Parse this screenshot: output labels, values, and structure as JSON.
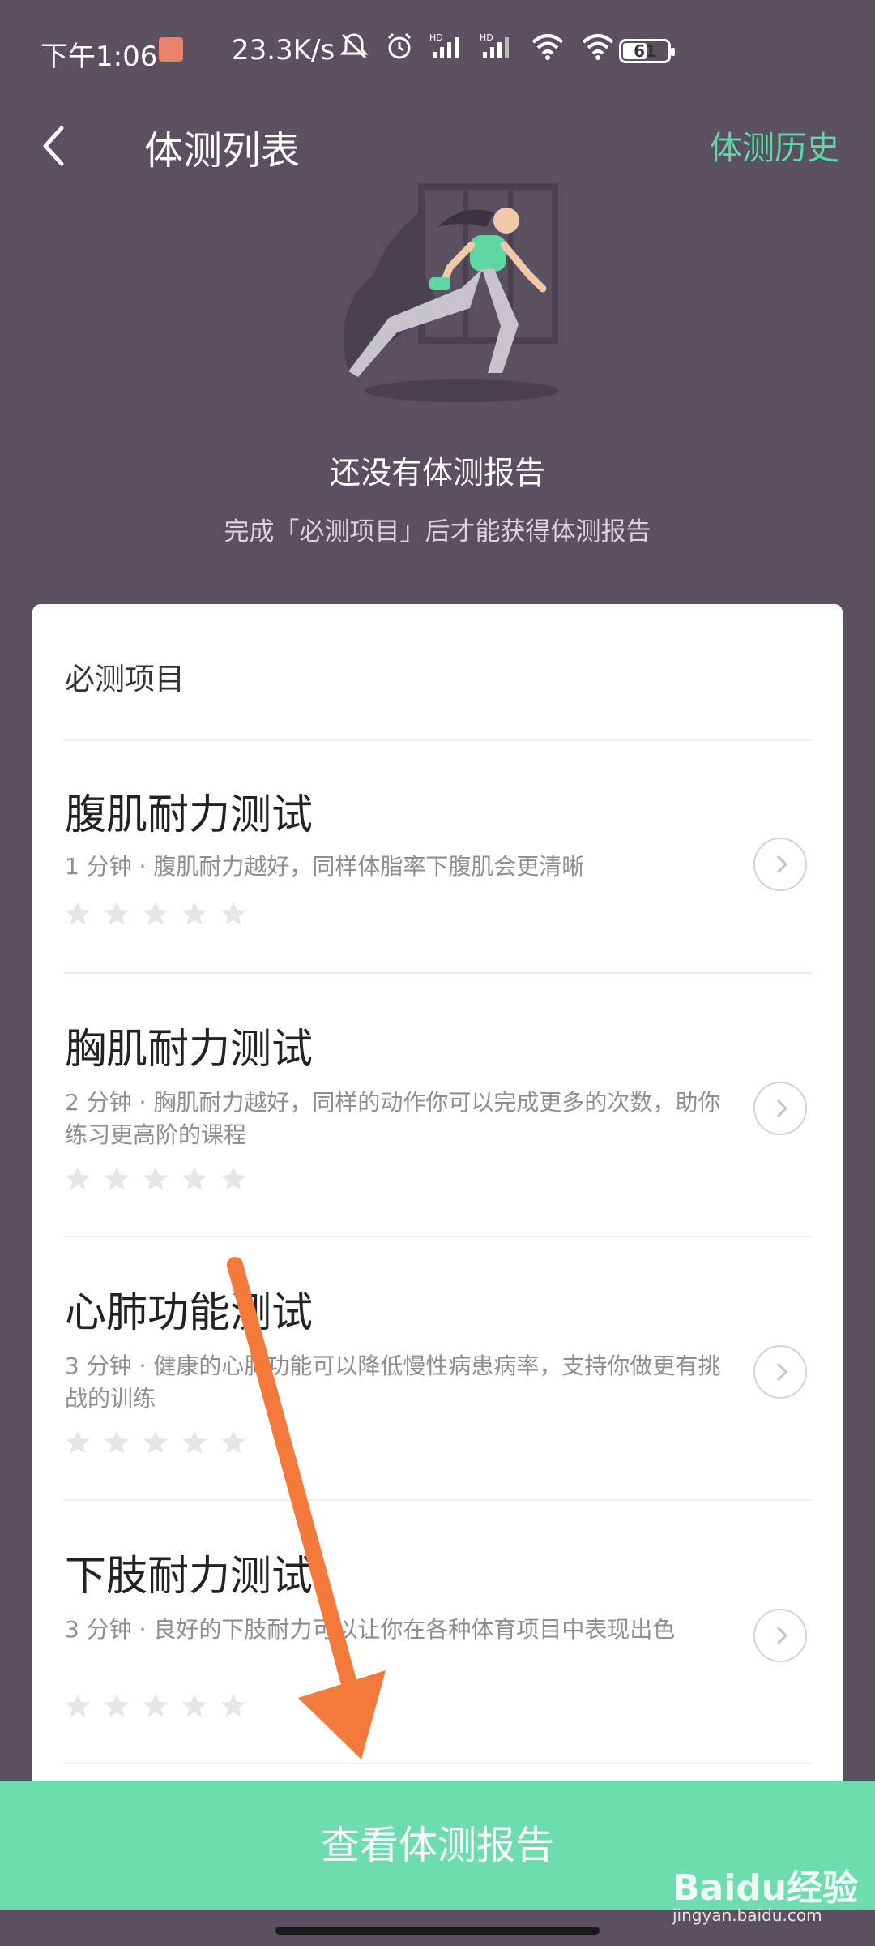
{
  "status_bar": {
    "time": "下午1:06",
    "network_speed": "23.3K/s",
    "battery_level": "61",
    "icons": [
      "mute-icon",
      "alarm-icon",
      "hd-signal-icon",
      "hd-signal-icon",
      "wifi-icon",
      "wifi-icon",
      "battery-icon"
    ]
  },
  "header": {
    "title": "体测列表",
    "history_link": "体测历史"
  },
  "empty_state": {
    "title": "还没有体测报告",
    "description": "完成「必测项目」后才能获得体测报告"
  },
  "section": {
    "title": "必测项目",
    "items": [
      {
        "title": "腹肌耐力测试",
        "description": "1 分钟 · 腹肌耐力越好，同样体脂率下腹肌会更清晰",
        "rating": 0,
        "rating_max": 5
      },
      {
        "title": "胸肌耐力测试",
        "description": "2 分钟 · 胸肌耐力越好，同样的动作你可以完成更多的次数，助你练习更高阶的课程",
        "rating": 0,
        "rating_max": 5
      },
      {
        "title": "心肺功能测试",
        "description": "3 分钟 · 健康的心肺功能可以降低慢性病患病率，支持你做更有挑战的训练",
        "rating": 0,
        "rating_max": 5
      },
      {
        "title": "下肢耐力测试",
        "description": "3 分钟 · 良好的下肢耐力可以让你在各种体育项目中表现出色",
        "rating": 0,
        "rating_max": 5
      }
    ]
  },
  "footer": {
    "button_label": "查看体测报告"
  },
  "watermark": {
    "brand": "Baidu经验",
    "url": "jingyan.baidu.com"
  },
  "colors": {
    "background": "#5a5060",
    "accent": "#5ed7a5",
    "button": "#6dddb0",
    "annotation_arrow": "#f47a3c"
  }
}
